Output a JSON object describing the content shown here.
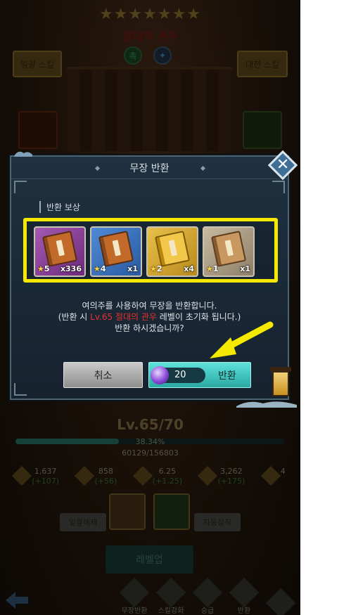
{
  "background": {
    "stars": "★★★★★★★",
    "hero_name": "절대의 관우",
    "faction_a": "촉",
    "faction_b": "✦",
    "left_button": "일괄 스킬",
    "right_button": "대전 스킬",
    "level": "Lv.65/70",
    "exp_percent_label": "38.34%",
    "exp_percent": 0.3834,
    "exp_values": "60129/156803",
    "stats": [
      {
        "value": "1,637",
        "plus": "(+107)"
      },
      {
        "value": "858",
        "plus": "(+56)"
      },
      {
        "value": "6.25",
        "plus": "(+1.25)"
      },
      {
        "value": "3,262",
        "plus": "(+175)"
      },
      {
        "value": "4",
        "plus": ""
      }
    ],
    "unequip_all": "일괄해제",
    "auto_equip": "자동장착",
    "level_up": "레벨업",
    "nav": [
      "무장반환",
      "스킬강화",
      "승급",
      "반환"
    ]
  },
  "modal": {
    "title": "무장 반환",
    "reward_label": "반환 보상",
    "items": [
      {
        "stars": "5",
        "qty": "x336",
        "bg": "purple",
        "book": "red"
      },
      {
        "stars": "4",
        "qty": "x1",
        "bg": "blue",
        "book": "red"
      },
      {
        "stars": "2",
        "qty": "x4",
        "bg": "gold",
        "book": "gold"
      },
      {
        "stars": "1",
        "qty": "x1",
        "bg": "grey",
        "book": "tan"
      }
    ],
    "message_line1": "여의주를 사용하여 무장을 반환합니다.",
    "message_line2_prefix": "(반환 시 ",
    "message_line2_highlight": "Lv.65 절대의 관우",
    "message_line2_suffix": " 레벨이 초기화 됩니다.)",
    "message_line3": "반환 하시겠습니까?",
    "cancel": "취소",
    "cost": "20",
    "confirm": "반환"
  },
  "colors": {
    "highlight_frame": "#f6e900",
    "arrow": "#f6e900",
    "warning_text": "#e53030",
    "confirm_button": "#3cc6be"
  },
  "icons": {
    "close": "close-icon",
    "orb": "dragon-orb-icon",
    "arrow": "pointer-arrow"
  }
}
